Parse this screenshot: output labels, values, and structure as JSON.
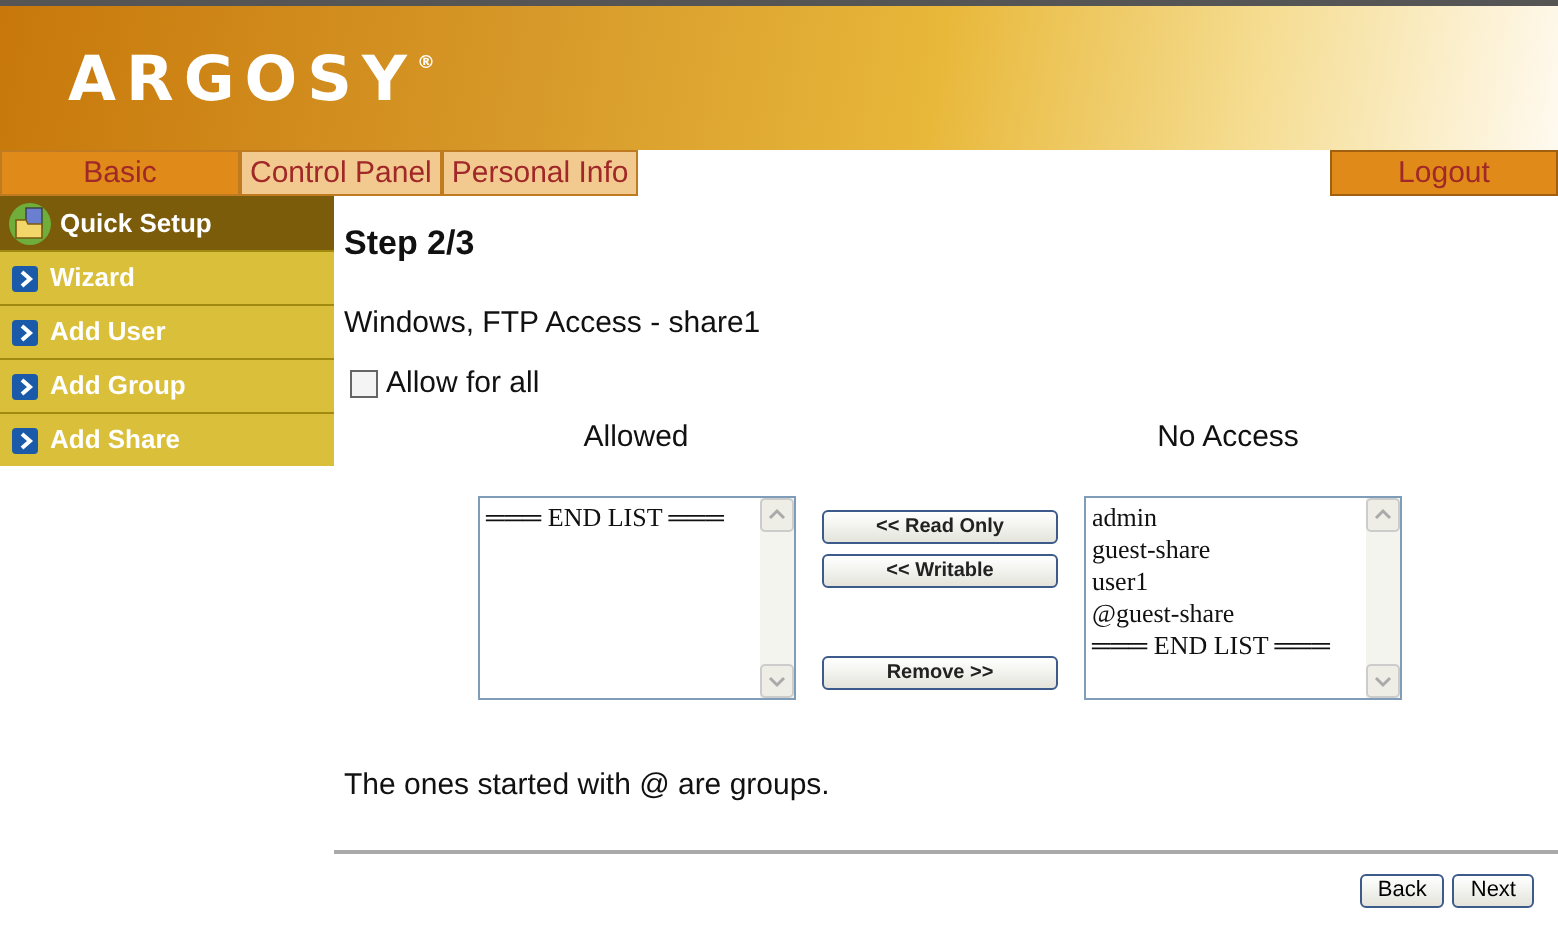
{
  "header": {
    "logo": "ARGOSY$^{®}$"
  },
  "tabs": [
    {
      "label": "Basic",
      "selected": true
    },
    {
      "label": "Control Panel",
      "selected": false
    },
    {
      "label": "Personal Info",
      "selected": false
    }
  ],
  "logout": "Logout",
  "sidebar": {
    "title": "Quick Setup",
    "items": [
      "Wizard",
      "Add User",
      "Add Group",
      "Add Share"
    ]
  },
  "step": "Step 2/3",
  "subtitle": "Windows, FTP Access - share1",
  "allow_all": {
    "label": "Allow for all",
    "checked": false
  },
  "allowed": {
    "heading": "Allowed",
    "items": [
      "═══ END LIST ═══"
    ]
  },
  "no_access": {
    "heading": "No Access",
    "items": [
      "admin",
      "guest-share",
      "user1",
      "@guest-share",
      "═══ END LIST ═══"
    ]
  },
  "action_groups": [
    [
      "<< Read Only",
      "<< Writable"
    ],
    [
      "Remove >>"
    ]
  ],
  "note": "The ones started with @ are groups.",
  "nav_buttons": [
    "Back",
    "Next"
  ]
}
